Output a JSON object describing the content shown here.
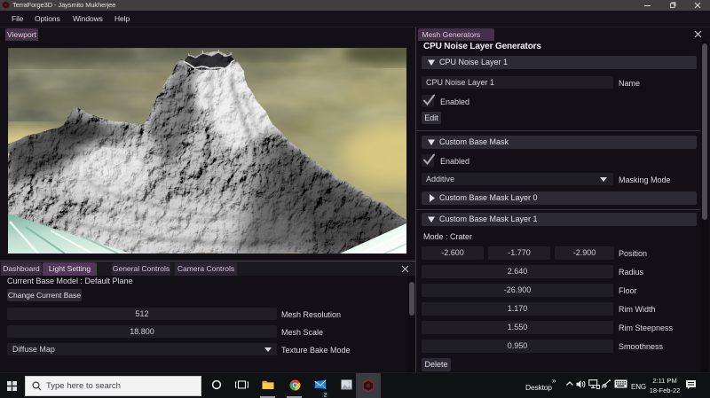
{
  "window": {
    "title": "TerraForge3D - Jaysmito Mukherjee",
    "controls": {
      "minimize": "minimize",
      "maximize": "maximize",
      "close": "close"
    }
  },
  "menubar": {
    "items": [
      "File",
      "Options",
      "Windows",
      "Help"
    ]
  },
  "viewport_panel": {
    "tab": "Viewport",
    "scene_description": "3D rendered volcanic mountain with crater on olive-yellow cloudy sky"
  },
  "bottom_panel": {
    "tabs": [
      {
        "label": "Dashboard",
        "state": "selected"
      },
      {
        "label": "Light Setting",
        "state": "highlighted"
      },
      {
        "label": "General Controls",
        "state": "normal"
      },
      {
        "label": "Camera Controls",
        "state": "normal"
      }
    ],
    "current_base_model": "Current Base Model : Default Plane",
    "change_base_button": "Change Current Base",
    "mesh_resolution": {
      "value": "512",
      "label": "Mesh Resolution"
    },
    "mesh_scale": {
      "value": "18.800",
      "label": "Mesh Scale"
    },
    "texture_bake_mode": {
      "value": "Diffuse Map",
      "label": "Texture Bake Mode"
    }
  },
  "right_panel": {
    "tab": "Mesh Generators",
    "title": "CPU Noise Layer Generators",
    "noise_layer": {
      "header": "CPU Noise Layer 1",
      "name_value": "CPU Noise Layer 1",
      "name_label": "Name",
      "enabled_label": "Enabled",
      "edit_button": "Edit"
    },
    "custom_base_mask": {
      "header": "Custom Base Mask",
      "enabled_label": "Enabled",
      "masking_mode_value": "Additive",
      "masking_mode_label": "Masking Mode",
      "layer0_header": "Custom Base Mask Layer 0",
      "layer1_header": "Custom Base Mask Layer 1",
      "mode_text": "Mode : Crater",
      "position": {
        "values": [
          "-2.600",
          "-1.770",
          "-2.900"
        ],
        "label": "Position"
      },
      "params": [
        {
          "value": "2.640",
          "label": "Radius"
        },
        {
          "value": "-26.900",
          "label": "Floor"
        },
        {
          "value": "1.170",
          "label": "Rim Width"
        },
        {
          "value": "1.550",
          "label": "Rim Steepness"
        },
        {
          "value": "0.950",
          "label": "Smoothness"
        }
      ],
      "delete_button": "Delete"
    }
  },
  "taskbar": {
    "search_placeholder": "Type here to search",
    "desktop_label": "Desktop",
    "overflow_chevrons": "»",
    "language": "ENG",
    "time": "2:11 PM",
    "date": "18-Feb-22",
    "mail_badge": "2"
  },
  "colors": {
    "accent_purple": "#523858",
    "tab_purple": "#45304a",
    "panel_bg": "#121016",
    "frame_bg": "#1f1e24",
    "header_bg": "#2c2a32",
    "titlebar_bg": "#413e3f"
  }
}
